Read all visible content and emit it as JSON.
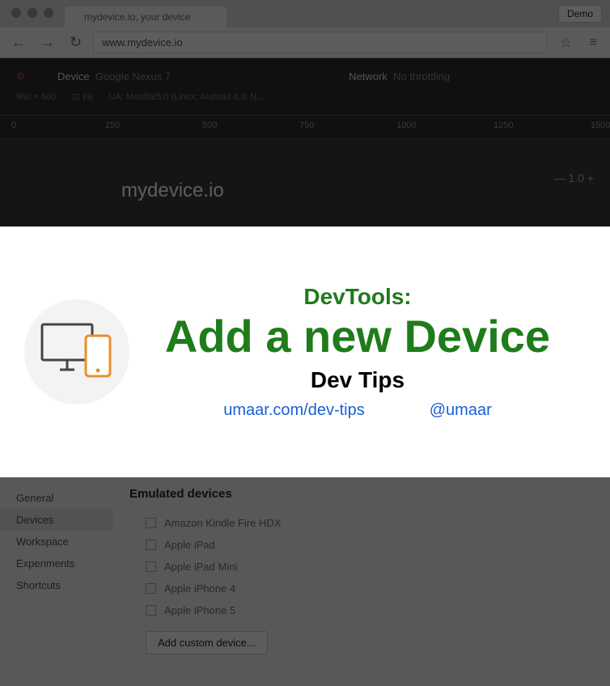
{
  "browser": {
    "tab_title": "mydevice.io, your device",
    "demo_button": "Demo",
    "url": "www.mydevice.io"
  },
  "devtools": {
    "device_label": "Device",
    "device_value": "Google Nexus 7",
    "network_label": "Network",
    "network_value": "No throttling",
    "dims": "960 × 600",
    "fit_label": "Fit",
    "ua_label": "UA:",
    "ua_value": "Mozilla/5.0 (Linux; Android 4.3; N...",
    "ruler_marks": [
      "0",
      "250",
      "500",
      "750",
      "1000",
      "1250",
      "1500"
    ],
    "site_title": "mydevice.io",
    "zoom": "1.0"
  },
  "settings": {
    "sidebar": [
      "General",
      "Devices",
      "Workspace",
      "Experiments",
      "Shortcuts"
    ],
    "active_index": 1,
    "heading": "Emulated devices",
    "devices": [
      "Amazon Kindle Fire HDX",
      "Apple iPad",
      "Apple iPad Mini",
      "Apple iPhone 4",
      "Apple iPhone 5"
    ],
    "add_button": "Add custom device..."
  },
  "card": {
    "eyebrow": "DevTools:",
    "title": "Add a new Device",
    "subtitle": "Dev Tips",
    "link1": "umaar.com/dev-tips",
    "link2": "@umaar"
  }
}
